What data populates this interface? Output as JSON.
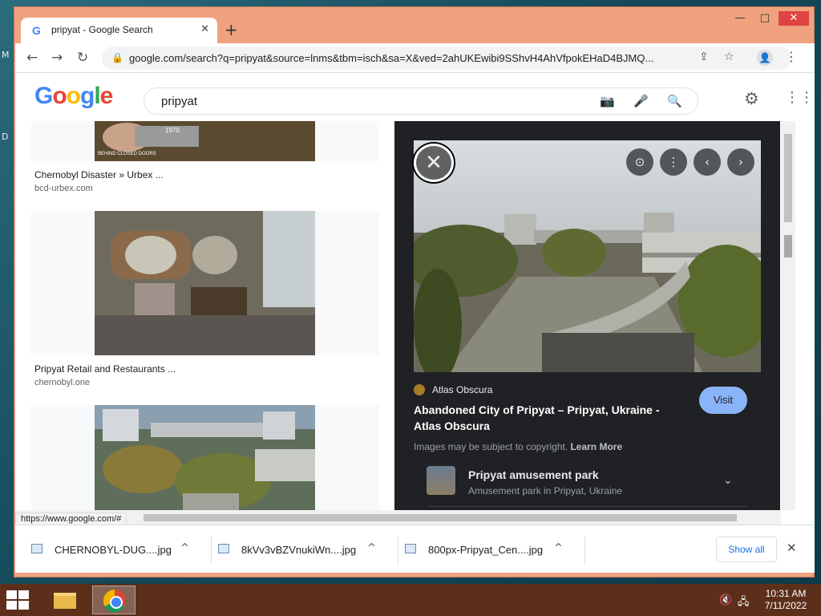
{
  "desktop": {
    "letters": [
      "M",
      "D"
    ]
  },
  "window": {
    "controls": {
      "minimize": "—",
      "maximize": "□",
      "close": "✕"
    }
  },
  "tab": {
    "title": "pripyat - Google Search",
    "favicon": "G",
    "close": "✕",
    "new_tab": "+"
  },
  "toolbar": {
    "back": "←",
    "forward": "→",
    "reload": "↻",
    "url": "google.com/search?q=pripyat&source=lnms&tbm=isch&sa=X&ved=2ahUKEwibi9SShvH4AhVfpokEHaD4BJMQ...",
    "share_icon": "⇪",
    "star_icon": "☆",
    "profile_icon": "👤",
    "menu_icon": "⋮"
  },
  "google": {
    "logo": [
      "G",
      "o",
      "o",
      "g",
      "l",
      "e"
    ],
    "logo_colors": [
      "#4285f4",
      "#ea4335",
      "#fbbc05",
      "#4285f4",
      "#34a853",
      "#ea4335"
    ],
    "query": "pripyat",
    "camera_icon": "📷",
    "mic_icon": "🎤",
    "search_icon": "🔍",
    "settings_icon": "⚙",
    "apps_icon": "⋮⋮"
  },
  "results": [
    {
      "title": "Chernobyl Disaster » Urbex ...",
      "domain": "bcd-urbex.com",
      "overlay": "BEHIND CLOSED DOORS",
      "photo_date": "1970"
    },
    {
      "title": "Pripyat Retail and Restaurants ...",
      "domain": "chernobyl.one"
    },
    {
      "title": "",
      "domain": ""
    }
  ],
  "preview": {
    "close_icon": "✕",
    "lens_icon": "⊙",
    "more_icon": "⋮",
    "prev_icon": "‹",
    "next_icon": "›",
    "source": "Atlas Obscura",
    "title": "Abandoned City of Pripyat – Pripyat, Ukraine - Atlas Obscura",
    "visit": "Visit",
    "copyright": "Images may be subject to copyright.",
    "learn_more": "Learn More",
    "related": {
      "title": "Pripyat amusement park",
      "subtitle": "Amusement park in Pripyat, Ukraine",
      "chevron": "⌄"
    }
  },
  "status_url": "https://www.google.com/#",
  "downloads": [
    {
      "name": "CHERNOBYL-DUG....jpg",
      "chevron": "^"
    },
    {
      "name": "8kVv3vBZVnukiWn....jpg",
      "chevron": "^"
    },
    {
      "name": "800px-Pripyat_Cen....jpg",
      "chevron": "^"
    }
  ],
  "shelf": {
    "show_all": "Show all",
    "close": "✕"
  },
  "taskbar": {
    "volume_icon": "🔇",
    "network_icon": "🖧",
    "time": "10:31 AM",
    "date": "7/11/2022"
  }
}
